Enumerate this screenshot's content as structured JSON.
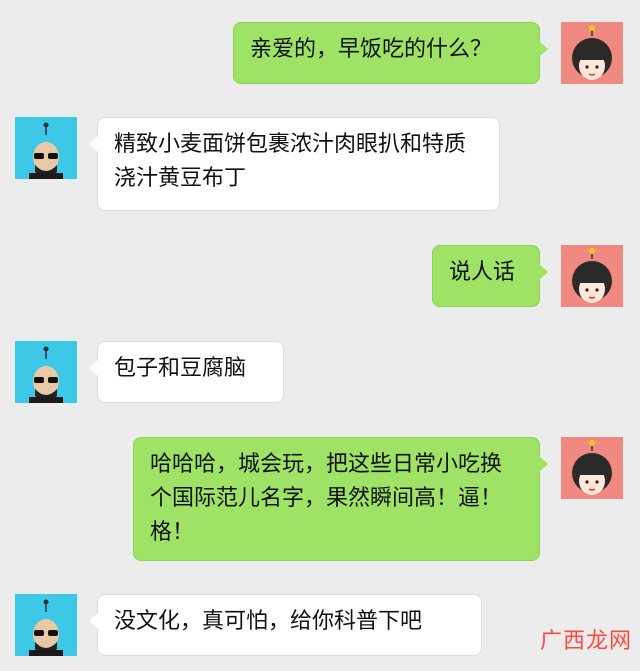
{
  "chat": {
    "messages": [
      {
        "from": "me",
        "text": "亲爱的，早饭吃的什么？"
      },
      {
        "from": "friend",
        "text": "精致小麦面饼包裹浓汁肉眼扒和特质浇汁黄豆布丁"
      },
      {
        "from": "me",
        "text": "说人话"
      },
      {
        "from": "friend",
        "text": "包子和豆腐脑"
      },
      {
        "from": "me",
        "text": "哈哈哈，城会玩，把这些日常小吃换个国际范儿名字，果然瞬间高！逼！格！"
      },
      {
        "from": "friend",
        "text": "没文化，真可怕，给你科普下吧"
      }
    ]
  },
  "watermark": {
    "text": "广西龙网"
  },
  "colors": {
    "my_bubble": "#9ee366",
    "their_bubble": "#ffffff",
    "background": "#ececec",
    "girl_avatar": "#f08a80",
    "boy_avatar": "#3ec8e8"
  }
}
